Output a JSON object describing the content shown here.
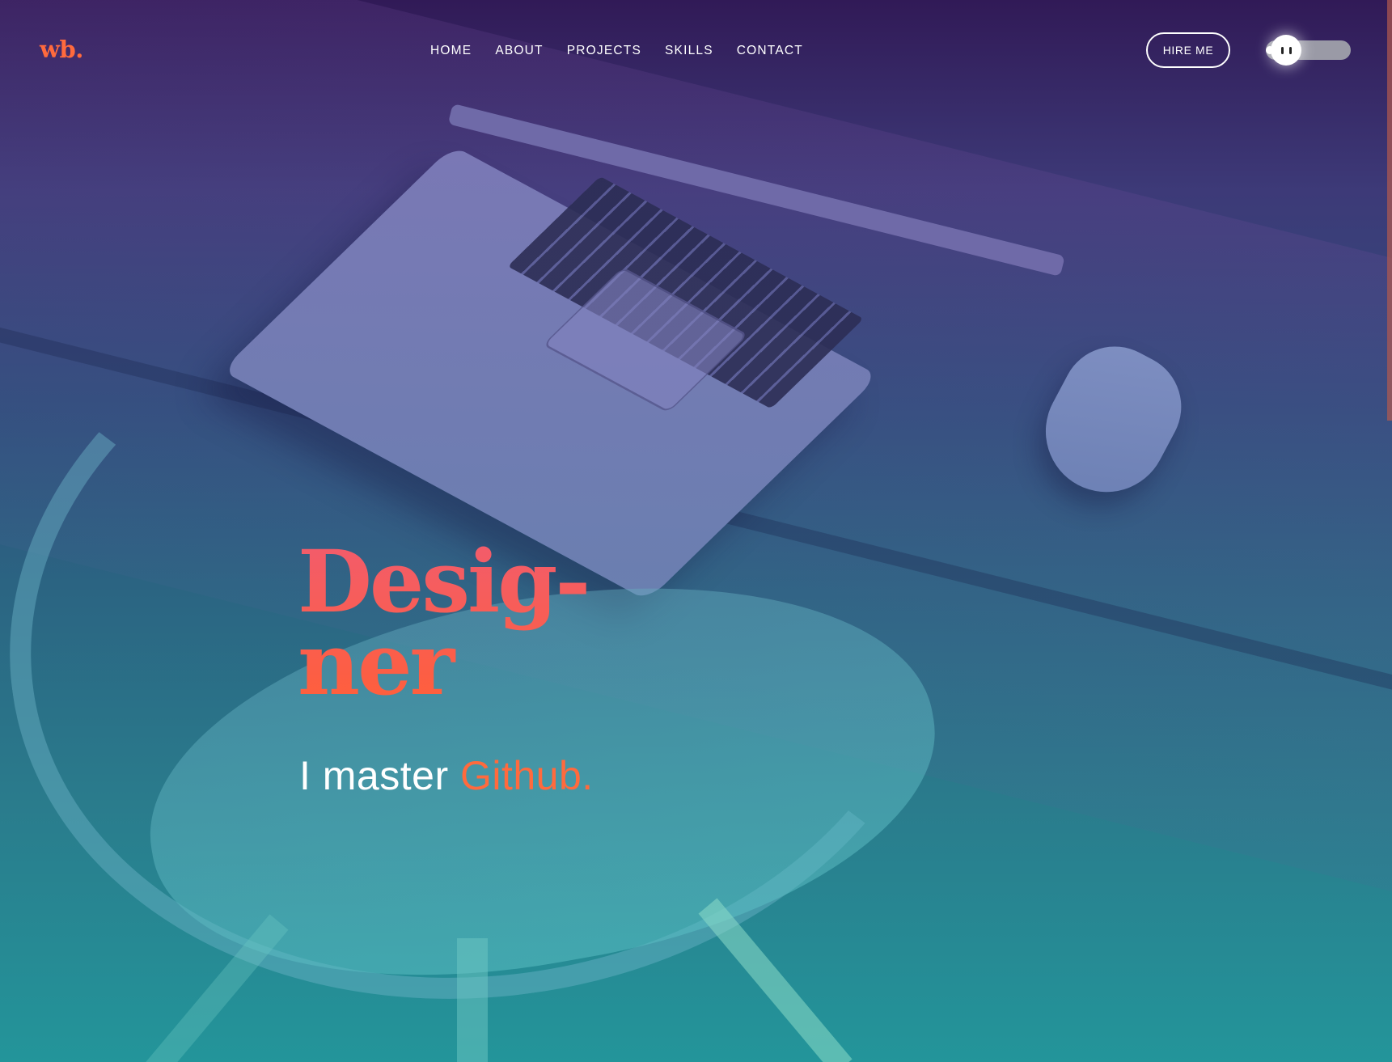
{
  "logo": {
    "text": "wb."
  },
  "nav": {
    "items": [
      {
        "label": "HOME"
      },
      {
        "label": "ABOUT"
      },
      {
        "label": "PROJECTS"
      },
      {
        "label": "SKILLS"
      },
      {
        "label": "CONTACT"
      }
    ]
  },
  "hire_button": {
    "label": "HIRE ME"
  },
  "theme_toggle": {
    "state": "off"
  },
  "hero": {
    "title_line1": "Desig-",
    "title_line2": "ner",
    "subtitle_prefix": "I master ",
    "subtitle_highlight": "Github."
  },
  "colors": {
    "accent": "#ff6a3d",
    "title_gradient_top": "#f25c6c",
    "title_gradient_bottom": "#ff5f3b",
    "bg_top": "#311a57",
    "bg_bottom": "#23959a"
  },
  "icons": {
    "toggle_knob": "toggle-knob-icon"
  }
}
